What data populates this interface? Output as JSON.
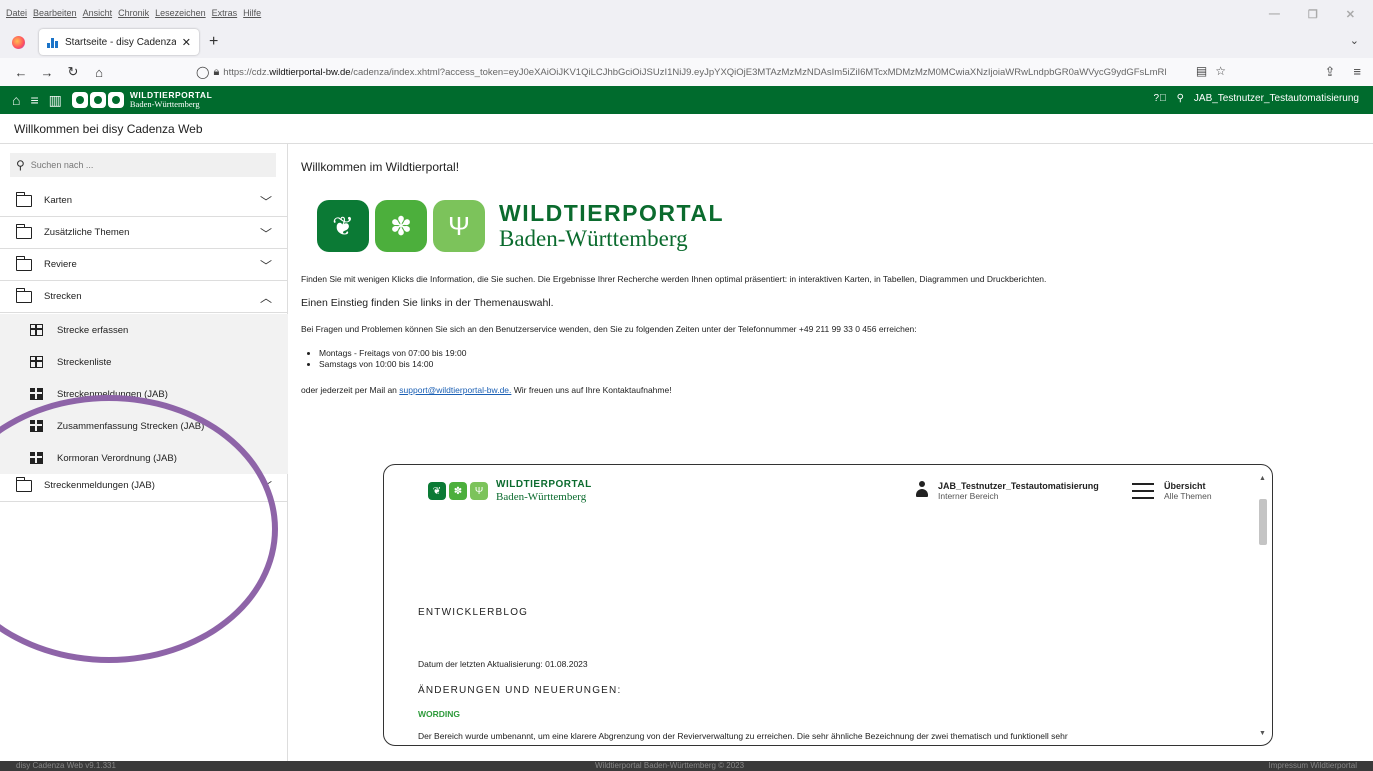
{
  "browser": {
    "menu": [
      "Datei",
      "Bearbeiten",
      "Ansicht",
      "Chronik",
      "Lesezeichen",
      "Extras",
      "Hilfe"
    ],
    "tab_title": "Startseite - disy Cadenza Web",
    "url_prefix": "https://cdz.",
    "url_domain": "wildtierportal-bw.de",
    "url_rest": "/cadenza/index.xhtml?access_token=eyJ0eXAiOiJKV1QiLCJhbGciOiJSUzI1NiJ9.eyJpYXQiOjE3MTAzMzMzNDAsIm5iZiI6MTcxMDMzMzM0MCwiaXNzIjoiaWRwLndpbGR0aWVycG9ydGFsLmRl"
  },
  "header": {
    "logo_line1": "WILDTIERPORTAL",
    "logo_line2": "Baden-Württemberg",
    "user": "JAB_Testnutzer_Testautomatisierung"
  },
  "page_title": "Willkommen bei disy Cadenza Web",
  "sidebar": {
    "search_placeholder": "Suchen nach ...",
    "items": [
      {
        "label": "Karten"
      },
      {
        "label": "Zusätzliche Themen"
      },
      {
        "label": "Reviere"
      },
      {
        "label": "Strecken"
      }
    ],
    "subitems": [
      {
        "label": "Strecke erfassen"
      },
      {
        "label": "Streckenliste"
      },
      {
        "label": "Streckenmeldungen (JAB)"
      },
      {
        "label": "Zusammenfassung Strecken (JAB)"
      },
      {
        "label": "Kormoran Verordnung (JAB)"
      }
    ],
    "last_item": "Streckenmeldungen (JAB)"
  },
  "main": {
    "welcome": "Willkommen im Wildtierportal!",
    "logo_line1": "WILDTIERPORTAL",
    "logo_line2": "Baden-Württemberg",
    "p1": "Finden Sie mit wenigen Klicks die Information, die Sie suchen. Die Ergebnisse Ihrer Recherche werden Ihnen optimal präsentiert: in interaktiven Karten, in Tabellen, Diagrammen und Druckberichten.",
    "p2": "Einen Einstieg finden Sie links in der Themenauswahl.",
    "p3": "Bei Fragen und Problemen können Sie sich an den Benutzerservice wenden, den Sie zu folgenden Zeiten unter der Telefonnummer +49 211 99 33 0 456 erreichen:",
    "bullets": [
      "Montags - Freitags von 07:00 bis 19:00",
      "Samstags von 10:00 bis 14:00"
    ],
    "p4_pre": "oder jederzeit per Mail an ",
    "p4_link": "support@wildtierportal-bw.de.",
    "p4_post": " Wir freuen uns auf Ihre Kontaktaufnahme!"
  },
  "frame": {
    "logo_line1": "WILDTIERPORTAL",
    "logo_line2": "Baden-Württemberg",
    "user": "JAB_Testnutzer_Testautomatisierung",
    "user_sub": "Interner Bereich",
    "menu_title": "Übersicht",
    "menu_sub": "Alle Themen",
    "blog_title": "ENTWICKLERBLOG",
    "date": "Datum der letzten Aktualisierung: 01.08.2023",
    "section": "ÄNDERUNGEN UND NEUERUNGEN:",
    "wording": "WORDING",
    "text": "Der Bereich wurde umbenannt, um eine klarere Abgrenzung von der Revierverwaltung zu erreichen. Die sehr ähnliche Bezeichnung der zwei thematisch und funktionell sehr"
  },
  "footer": {
    "left": "disy Cadenza Web v9.1.331",
    "center": "Wildtierportal Baden-Württemberg © 2023",
    "right": "Impressum Wildtierportal"
  },
  "colors": {
    "header_green": "#006b2d",
    "accent_green": "#2e9b3b",
    "lasso": "#8e64a8"
  }
}
